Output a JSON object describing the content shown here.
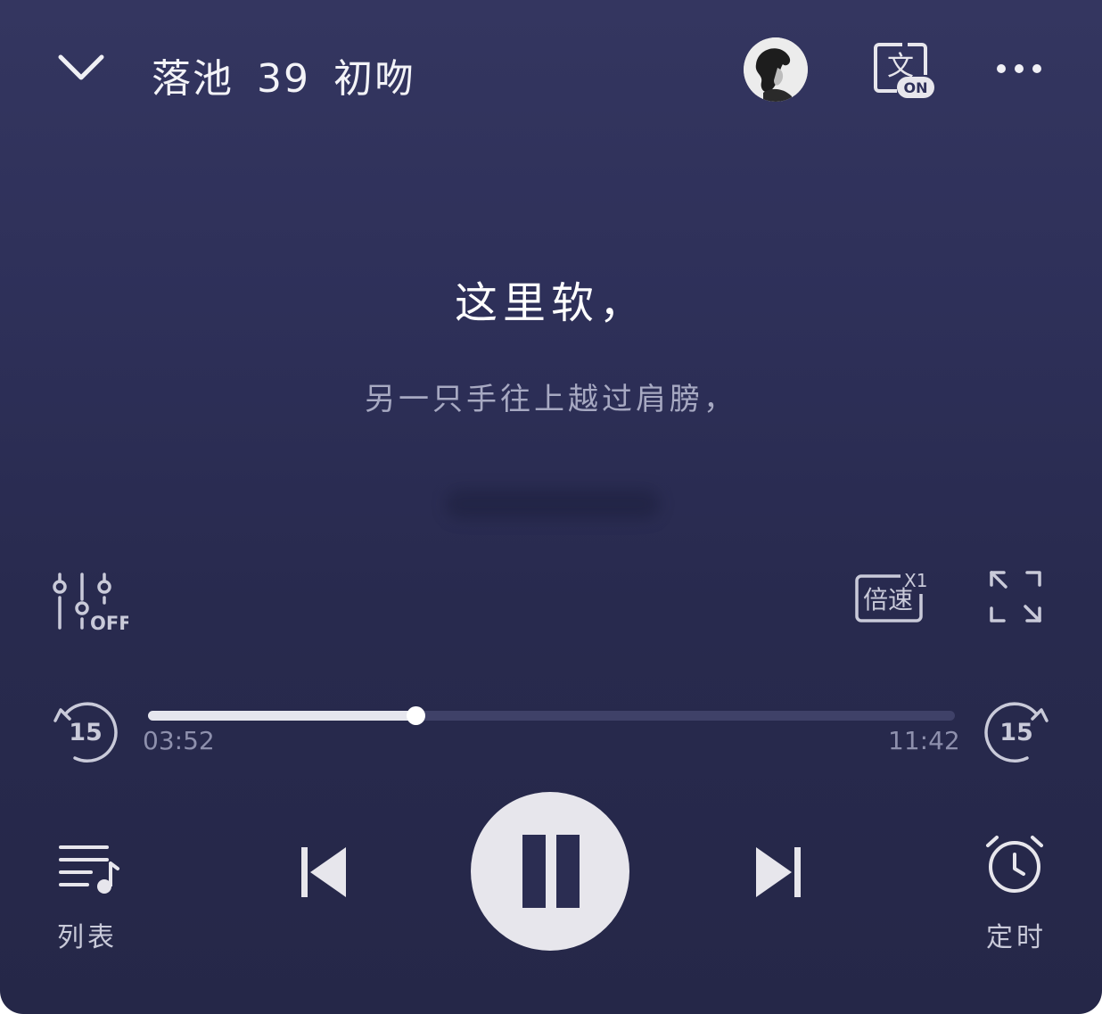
{
  "header": {
    "title_part1": "落池",
    "title_part2": "39",
    "title_part3": "初吻",
    "translate_badge_char": "文",
    "translate_badge_state": "ON"
  },
  "lyrics": {
    "current": "这里软，",
    "next": "另一只手往上越过肩膀，"
  },
  "tools": {
    "eq_state": "OFF",
    "speed_label": "倍速",
    "speed_value": "X1"
  },
  "progress": {
    "current_time": "03:52",
    "total_time": "11:42",
    "fraction": 0.331,
    "skip_back_seconds": "15",
    "skip_forward_seconds": "15"
  },
  "controls": {
    "list_label": "列表",
    "timer_label": "定时",
    "state": "playing"
  },
  "colors": {
    "background_top": "#343660",
    "background_bottom": "#252748",
    "foreground": "#e7e6ec",
    "muted": "#8e90ad"
  }
}
